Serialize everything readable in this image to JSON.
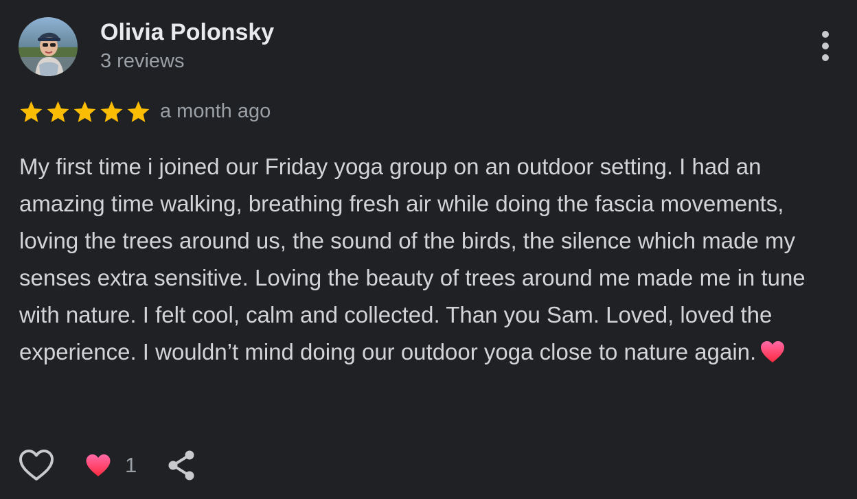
{
  "reviewer": {
    "name": "Olivia Polonsky",
    "review_count": "3 reviews"
  },
  "review": {
    "rating": 5,
    "max_rating": 5,
    "date": "a month ago",
    "text": "My first time i joined our Friday yoga group on an outdoor setting. I had an amazing time walking, breathing fresh air while doing the fascia movements, loving the trees around us, the sound of the birds, the silence which made my senses extra sensitive. Loving the beauty of trees around me made me in tune with nature. I felt cool, calm and collected. Than you Sam. Loved, loved the experience. I wouldn’t mind doing our outdoor yoga close to nature again.",
    "trailing_emoji": "heart-emoji"
  },
  "actions": {
    "like_icon": "heart-outline-icon",
    "reaction_icon": "heart-emoji",
    "reaction_count": "1",
    "share_icon": "share-icon",
    "more_icon": "more-vert-icon"
  },
  "colors": {
    "background": "#202124",
    "star": "#fbbc04",
    "primary_text": "#e8eaed",
    "secondary_text": "#9aa0a6",
    "heart_top": "#ff6aa8",
    "heart_bottom": "#ff2a3f"
  }
}
